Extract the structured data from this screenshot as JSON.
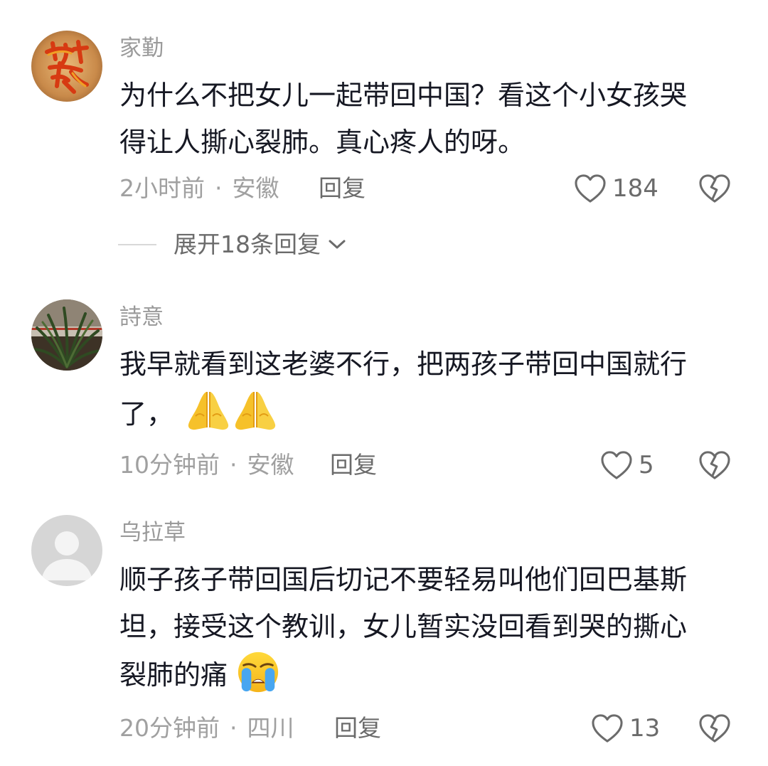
{
  "comments": [
    {
      "username": "家勤",
      "lines": [
        "为什么不把女儿一起带回中国？看这个小女孩哭",
        "得让人撕心裂肺。真心疼人的呀。"
      ],
      "time": "2小时前",
      "location": "安徽",
      "reply_label": "回复",
      "likes": "184",
      "avatar_icon": "calligraphy-avatar"
    },
    {
      "username": "詩意",
      "lines": [
        "我早就看到这老婆不行，把两孩子带回中国就行",
        "了，"
      ],
      "emoji_after_line2": [
        "folded-hands-emoji",
        "folded-hands-emoji"
      ],
      "time": "10分钟前",
      "location": "安徽",
      "reply_label": "回复",
      "likes": "5",
      "avatar_icon": "plant-photo-avatar"
    },
    {
      "username": "乌拉草",
      "lines": [
        "顺子孩子带回国后切记不要轻易叫他们回巴基斯",
        "坦，接受这个教训，女儿暂实没回看到哭的撕心",
        "裂肺的痛"
      ],
      "emoji_after_line3": [
        "loudly-crying-face-emoji"
      ],
      "time": "20分钟前",
      "location": "四川",
      "reply_label": "回复",
      "likes": "13",
      "avatar_icon": "default-user-avatar"
    }
  ],
  "expand_replies_label": "展开18条回复",
  "meta_separator": "·",
  "colors": {
    "username": "#9a9a9a",
    "body": "#161823",
    "meta": "#a0a0a0",
    "action": "#6b6b6b"
  }
}
